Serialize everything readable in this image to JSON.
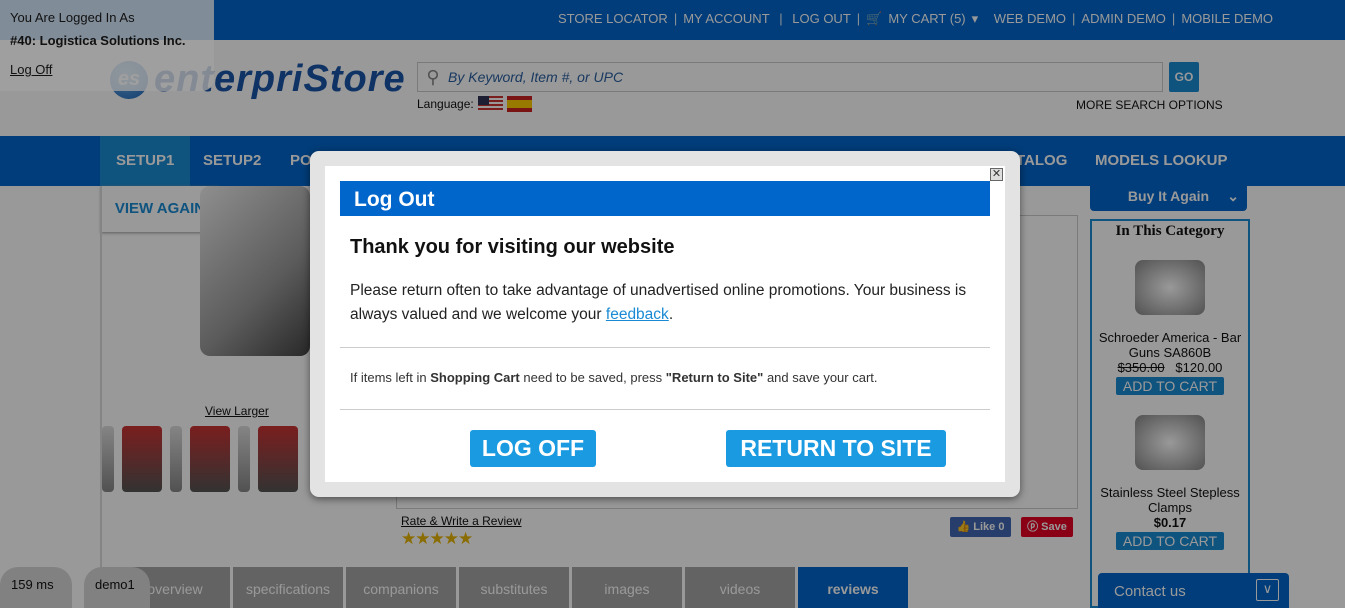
{
  "topbar": {
    "links": [
      "STORE LOCATOR",
      "MY ACCOUNT",
      "LOG OUT",
      "MY CART (5)",
      "WEB DEMO",
      "ADMIN DEMO",
      "MOBILE DEMO"
    ]
  },
  "header": {
    "logo_text": "enterpriStore",
    "logo_badge": "es",
    "search_placeholder": "By Keyword, Item #, or UPC",
    "go": "GO",
    "language_label": "Language:",
    "more_search": "MORE SEARCH OPTIONS"
  },
  "nav": {
    "items": [
      "SETUP1",
      "SETUP2",
      "PO",
      "TALOG",
      "MODELS LOOKUP"
    ],
    "dropdown": "VIEW AGAIN"
  },
  "product": {
    "view_larger": "View Larger",
    "rate_review": "Rate & Write a Review",
    "rating": 5,
    "like": "Like 0",
    "save": "Save"
  },
  "tabs": [
    "overview",
    "specifications",
    "companions",
    "substitutes",
    "images",
    "videos",
    "reviews"
  ],
  "sidebar": {
    "buy_it_again": "Buy It Again",
    "category_title": "In This Category",
    "items": [
      {
        "name": "Schroeder America - Bar Guns SA860B",
        "old_price": "$350.00",
        "price": "$120.00",
        "button": "ADD TO CART"
      },
      {
        "name": "Stainless Steel Stepless Clamps",
        "price": "$0.17",
        "button": "ADD TO CART"
      }
    ]
  },
  "contact": "Contact us",
  "status": {
    "timing": "159 ms",
    "user": "demo1"
  },
  "login_panel": {
    "line1": "You Are Logged In As",
    "account": "#40: Logistica Solutions Inc.",
    "logoff": "Log Off"
  },
  "modal": {
    "header": "Log Out",
    "title": "Thank you for visiting our website",
    "text": "Please return often to take advantage of unadvertised online promotions. Your business is always valued and we welcome your",
    "link": "feedback",
    "note_pre": "If items left in",
    "note_cart": "Shopping Cart",
    "note_mid": "need to be saved, press",
    "note_btn": "\"Return to Site\"",
    "note_post": "and save your cart.",
    "logoff": "LOG OFF",
    "return": "RETURN TO SITE"
  }
}
